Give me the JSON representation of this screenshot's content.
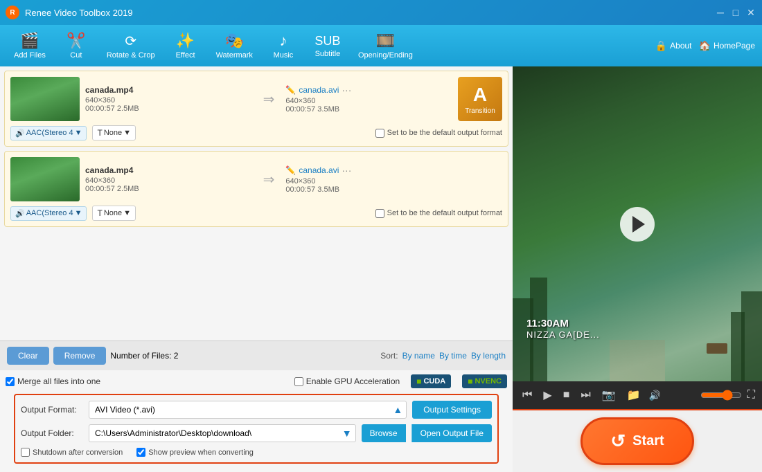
{
  "app": {
    "title": "Renee Video Toolbox 2019",
    "logo_text": "R"
  },
  "toolbar": {
    "items": [
      {
        "id": "add-files",
        "label": "Add Files",
        "icon": "🎬"
      },
      {
        "id": "cut",
        "label": "Cut",
        "icon": "✂️"
      },
      {
        "id": "rotate-crop",
        "label": "Rotate & Crop",
        "icon": "⟳"
      },
      {
        "id": "effect",
        "label": "Effect",
        "icon": "✨"
      },
      {
        "id": "watermark",
        "label": "Watermark",
        "icon": "🎭"
      },
      {
        "id": "music",
        "label": "Music",
        "icon": "♪"
      },
      {
        "id": "subtitle",
        "label": "Subtitle",
        "icon": "📝"
      },
      {
        "id": "opening-ending",
        "label": "Opening/Ending",
        "icon": "🎞️"
      }
    ],
    "about": "About",
    "homepage": "HomePage"
  },
  "file_items": [
    {
      "id": 1,
      "name": "canada.mp4",
      "resolution": "640×360",
      "duration": "00:00:57",
      "size": "2.5MB",
      "output_name": "canada.avi",
      "output_resolution": "640×360",
      "output_duration": "00:00:57",
      "output_size": "3.5MB",
      "audio": "AAC(Stereo 4",
      "subtitle": "None",
      "transition_label": "Transition"
    },
    {
      "id": 2,
      "name": "canada.mp4",
      "resolution": "640×360",
      "duration": "00:00:57",
      "size": "2.5MB",
      "output_name": "canada.avi",
      "output_resolution": "640×360",
      "output_duration": "00:00:57",
      "output_size": "3.5MB",
      "audio": "AAC(Stereo 4",
      "subtitle": "None",
      "transition_label": "Transition"
    }
  ],
  "bottom_controls": {
    "clear_label": "Clear",
    "remove_label": "Remove",
    "file_count_label": "Number of Files:",
    "file_count": "2",
    "sort_label": "Sort:",
    "sort_by_name": "By name",
    "sort_by_time": "By time",
    "sort_by_length": "By length"
  },
  "settings": {
    "merge_label": "Merge all files into one",
    "gpu_label": "Enable GPU Acceleration",
    "cuda_label": "CUDA",
    "nvenc_label": "NVENC",
    "output_format_label": "Output Format:",
    "output_format_value": "AVI Video (*.avi)",
    "output_settings_label": "Output Settings",
    "output_folder_label": "Output Folder:",
    "output_folder_value": "C:\\Users\\Administrator\\Desktop\\download\\",
    "browse_label": "Browse",
    "open_output_label": "Open Output File",
    "shutdown_label": "Shutdown after conversion",
    "show_preview_label": "Show preview when converting"
  },
  "video_preview": {
    "time_text": "11:30AM",
    "place_text": "NIZZA GA[DE...",
    "play_label": "Play"
  },
  "start_button": {
    "label": "Start",
    "icon": "↺"
  },
  "window_controls": {
    "minimize": "─",
    "maximize": "□",
    "close": "✕"
  }
}
